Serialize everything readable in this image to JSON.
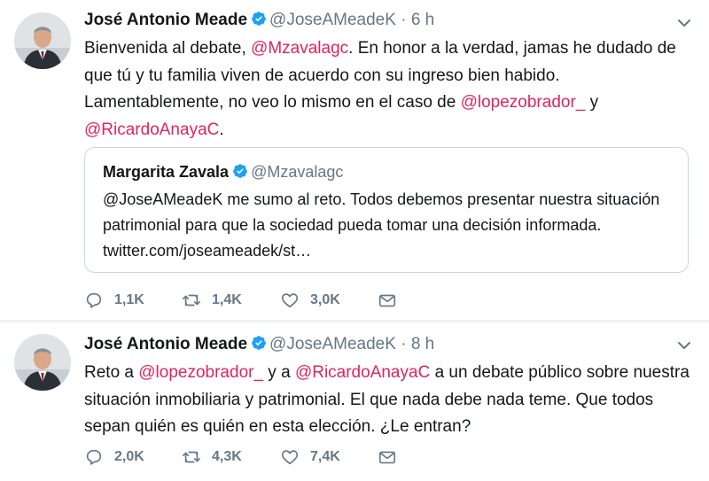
{
  "tweets": [
    {
      "author": "José Antonio Meade",
      "handle": "@JoseAMeadeK",
      "separator": "·",
      "time": "6 h",
      "text_segments": [
        {
          "text": "Bienvenida al debate, ",
          "mention": false
        },
        {
          "text": "@Mzavalagc",
          "mention": true
        },
        {
          "text": ". En honor a la verdad, jamas he dudado de que tú y tu familia viven de acuerdo con su ingreso bien habido. Lamentablemente, no veo lo mismo en el caso de ",
          "mention": false
        },
        {
          "text": "@lopezobrador_",
          "mention": true
        },
        {
          "text": " y ",
          "mention": false
        },
        {
          "text": "@RicardoAnayaC",
          "mention": true
        },
        {
          "text": ".",
          "mention": false
        }
      ],
      "quote": {
        "author": "Margarita Zavala",
        "handle": "@Mzavalagc",
        "text": "@JoseAMeadeK me sumo al reto. Todos debemos presentar nuestra situación patrimonial para que la sociedad pueda tomar una decisión informada. twitter.com/joseameadek/st…"
      },
      "replies": "1,1K",
      "retweets": "1,4K",
      "likes": "3,0K"
    },
    {
      "author": "José Antonio Meade",
      "handle": "@JoseAMeadeK",
      "separator": "·",
      "time": "8 h",
      "text_segments": [
        {
          "text": "Reto a ",
          "mention": false
        },
        {
          "text": "@lopezobrador_",
          "mention": true
        },
        {
          "text": " y a ",
          "mention": false
        },
        {
          "text": "@RicardoAnayaC",
          "mention": true
        },
        {
          "text": " a un debate público sobre nuestra situación inmobiliaria y patrimonial. El que nada debe nada teme. Que todos sepan quién es quién en esta elección. ¿Le entran?",
          "mention": false
        }
      ],
      "replies": "2,0K",
      "retweets": "4,3K",
      "likes": "7,4K"
    }
  ],
  "colors": {
    "mention": "#e0245e",
    "secondary_text": "#657786",
    "verified": "#1da1f2",
    "border": "#e6ecf0"
  },
  "icons": [
    "verified-badge-icon",
    "chevron-down-icon",
    "reply-icon",
    "retweet-icon",
    "like-icon",
    "direct-message-icon"
  ]
}
